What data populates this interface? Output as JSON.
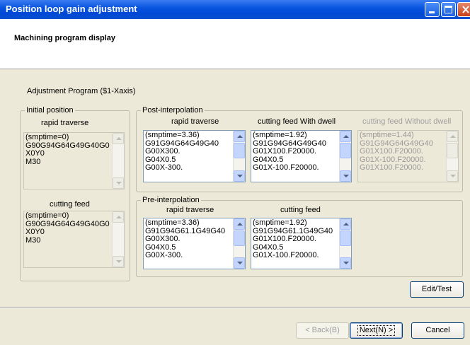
{
  "window": {
    "title": "Position loop gain adjustment"
  },
  "header": {
    "title": "Machining program display"
  },
  "program_label": "Adjustment Program ($1-Xaxis)",
  "initial": {
    "legend": "Initial position",
    "rapid_label": "rapid traverse",
    "rapid_lines": "(smptime=0)\nG90G94G64G49G40G0\nX0Y0\nM30",
    "cutting_label": "cutting feed",
    "cutting_lines": "(smptime=0)\nG90G94G64G49G40G0\nX0Y0\nM30"
  },
  "post": {
    "legend": "Post-interpolation",
    "rapid_label": "rapid traverse",
    "rapid_lines": "(smptime=3.36)\nG91G94G64G49G40\nG00X300.\nG04X0.5\nG00X-300.",
    "dwell_label": "cutting feed With dwell",
    "dwell_lines": "(smptime=1.92)\nG91G94G64G49G40\nG01X100.F20000.\nG04X0.5\nG01X-100.F20000.",
    "nodwell_label": "cutting feed Without dwell",
    "nodwell_lines": "(smptime=1.44)\nG91G94G64G49G40\nG01X100.F20000.\nG01X-100.F20000.\nG01X100.F20000."
  },
  "pre": {
    "legend": "Pre-interpolation",
    "rapid_label": "rapid traverse",
    "rapid_lines": "(smptime=3.36)\nG91G94G61.1G49G40\nG00X300.\nG04X0.5\nG00X-300.",
    "cutting_label": "cutting feed",
    "cutting_lines": "(smptime=1.92)\nG91G94G61.1G49G40\nG01X100.F20000.\nG04X0.5\nG01X-100.F20000."
  },
  "buttons": {
    "edit_test": "Edit/Test",
    "back": "< Back(B)",
    "next": "Next(N) >",
    "cancel": "Cancel"
  },
  "icons": {
    "minimize": "minimize-icon",
    "maximize": "maximize-icon",
    "close": "close-icon",
    "scroll_up": "scroll-up-arrow-icon",
    "scroll_down": "scroll-down-arrow-icon"
  },
  "colors": {
    "title_bar": "#0a56e0",
    "window_bg": "#ece9d8",
    "close_button": "#c8401a"
  }
}
